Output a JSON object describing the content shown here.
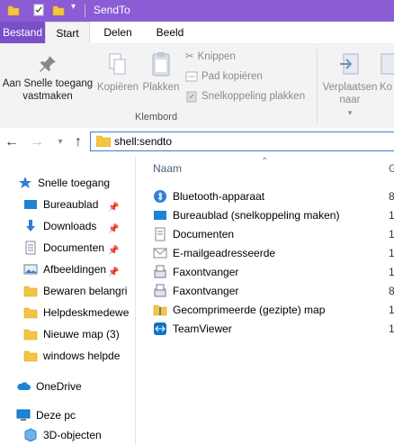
{
  "window": {
    "title": "SendTo",
    "accent": "#8b5cd4"
  },
  "tabs": [
    {
      "label": "Bestand"
    },
    {
      "label": "Start"
    },
    {
      "label": "Delen"
    },
    {
      "label": "Beeld"
    }
  ],
  "ribbon": {
    "pin_label": "Aan Snelle toegang vastmaken",
    "copy_label": "Kopiëren",
    "paste_label": "Plakken",
    "cut_label": "Knippen",
    "copy_path_label": "Pad kopiëren",
    "paste_shortcut_label": "Snelkoppeling plakken",
    "group_label": "Klembord",
    "move_label": "Verplaatsen naar",
    "copy_to_label": "Ko"
  },
  "address": {
    "path": "shell:sendto"
  },
  "nav": {
    "items": [
      {
        "label": "Snelle toegang",
        "icon": "star-icon"
      },
      {
        "label": "Bureaublad",
        "icon": "desktop-icon",
        "pinned": true
      },
      {
        "label": "Downloads",
        "icon": "download-icon",
        "pinned": true
      },
      {
        "label": "Documenten",
        "icon": "document-icon",
        "pinned": true
      },
      {
        "label": "Afbeeldingen",
        "icon": "pictures-icon",
        "pinned": true
      },
      {
        "label": "Bewaren belangri",
        "icon": "folder-icon"
      },
      {
        "label": "Helpdeskmedewe",
        "icon": "folder-icon"
      },
      {
        "label": "Nieuwe map (3)",
        "icon": "folder-icon"
      },
      {
        "label": "windows helpde",
        "icon": "folder-icon"
      },
      {
        "label": "OneDrive",
        "icon": "cloud-icon"
      },
      {
        "label": "Deze pc",
        "icon": "computer-icon"
      },
      {
        "label": "3D-objecten",
        "icon": "cube-icon"
      }
    ]
  },
  "list": {
    "col_name": "Naam",
    "col_next": "G",
    "files": [
      {
        "name": "Bluetooth-apparaat",
        "trunc": "8",
        "icon": "bluetooth-icon"
      },
      {
        "name": "Bureaublad (snelkoppeling maken)",
        "trunc": "1",
        "icon": "desktop-icon"
      },
      {
        "name": "Documenten",
        "trunc": "1",
        "icon": "document-icon"
      },
      {
        "name": "E-mailgeadresseerde",
        "trunc": "1",
        "icon": "mail-icon"
      },
      {
        "name": "Faxontvanger",
        "trunc": "1",
        "icon": "fax-icon"
      },
      {
        "name": "Faxontvanger",
        "trunc": "8",
        "icon": "fax-icon"
      },
      {
        "name": "Gecomprimeerde (gezipte) map",
        "trunc": "1",
        "icon": "zip-folder-icon"
      },
      {
        "name": "TeamViewer",
        "trunc": "1",
        "icon": "teamviewer-icon"
      }
    ]
  }
}
